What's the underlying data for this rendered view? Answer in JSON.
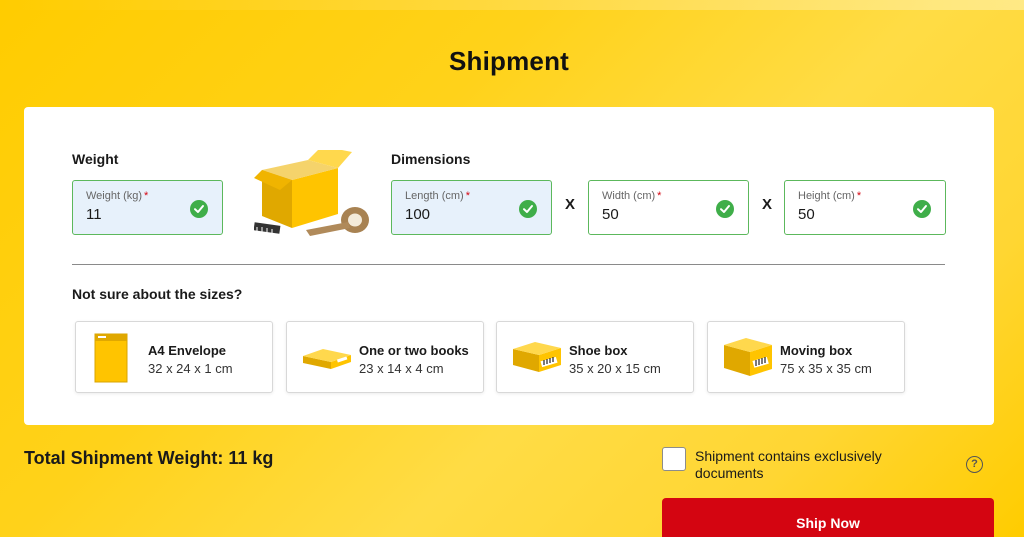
{
  "page": {
    "title": "Shipment"
  },
  "weight": {
    "section_label": "Weight",
    "field": {
      "label": "Weight (kg)",
      "required_mark": "*",
      "value": "11"
    }
  },
  "dimensions": {
    "section_label": "Dimensions",
    "separator": "X",
    "length": {
      "label": "Length (cm)",
      "required_mark": "*",
      "value": "100"
    },
    "width": {
      "label": "Width (cm)",
      "required_mark": "*",
      "value": "50"
    },
    "height": {
      "label": "Height (cm)",
      "required_mark": "*",
      "value": "50"
    }
  },
  "sizes": {
    "prompt": "Not sure about the sizes?",
    "presets": [
      {
        "name": "A4 Envelope",
        "size": "32 x 24 x 1 cm",
        "icon": "envelope-icon"
      },
      {
        "name": "One or two books",
        "size": "23 x 14 x 4 cm",
        "icon": "books-box-icon"
      },
      {
        "name": "Shoe box",
        "size": "35 x 20 x 15 cm",
        "icon": "shoe-box-icon"
      },
      {
        "name": "Moving box",
        "size": "75 x 35 x 35 cm",
        "icon": "moving-box-icon"
      }
    ]
  },
  "summary": {
    "total_weight_label": "Total Shipment Weight: 11 kg",
    "documents_checkbox_label": "Shipment contains exclusively documents",
    "documents_checked": false,
    "help_icon": "?"
  },
  "actions": {
    "ship_now_label": "Ship Now"
  },
  "colors": {
    "brand_yellow": "#ffcc00",
    "brand_red": "#d40511",
    "valid_green": "#3fae49",
    "filled_field_bg": "#e7f1fb"
  }
}
